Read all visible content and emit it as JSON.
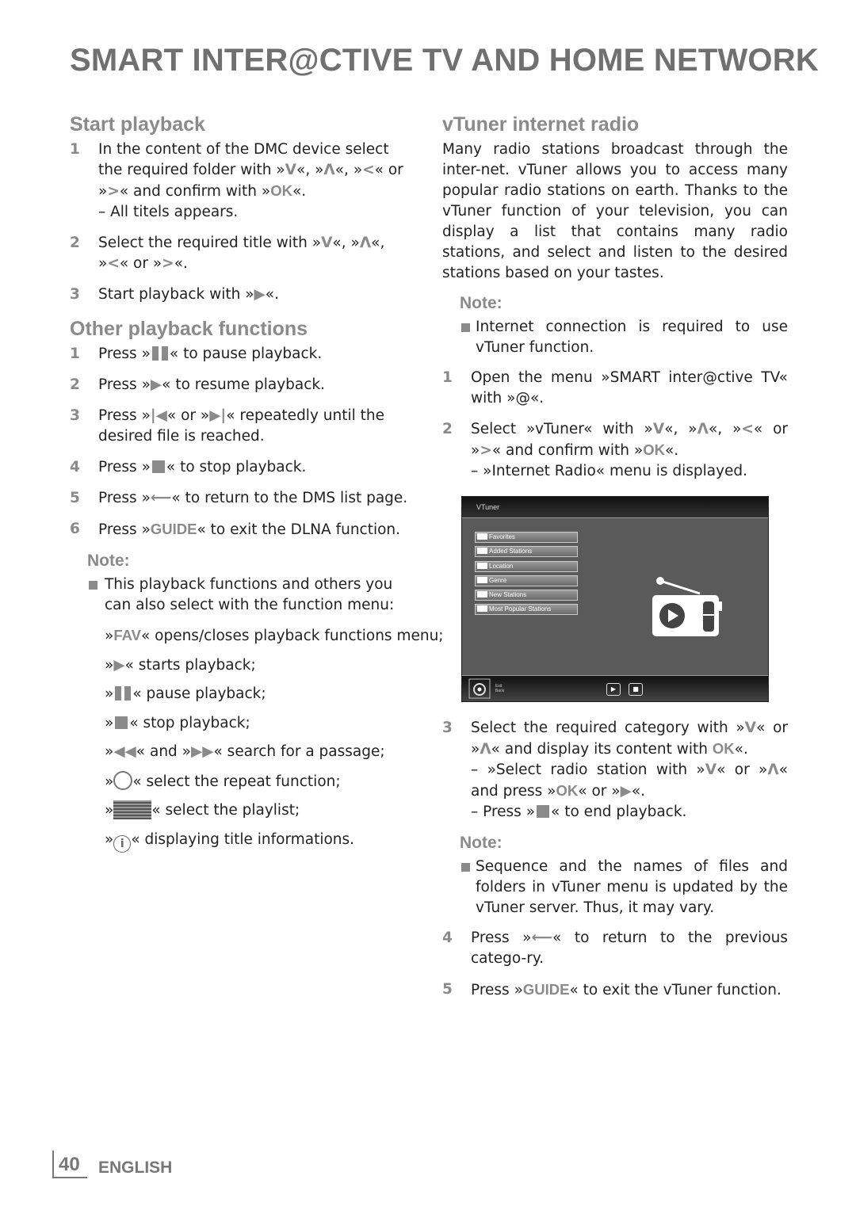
{
  "page_title": "SMART INTER@CTIVE TV AND HOME NETWORK",
  "colors": {
    "accent_gray": "#8a8a8a",
    "title_gray": "#707070"
  },
  "left": [
    {
      "type": "h",
      "text": "Start playback"
    },
    {
      "type": "step",
      "num": "1",
      "parts": [
        "In the content of the DMC device select the required folder with »",
        {
          "icon": "down"
        },
        "«, »",
        {
          "icon": "up"
        },
        "«, »",
        {
          "icon": "left"
        },
        "« or »",
        {
          "icon": "right"
        },
        "« and confirm with »",
        {
          "key": "OK"
        },
        "«."
      ],
      "sub": [
        "– All titels appears."
      ]
    },
    {
      "type": "step",
      "num": "2",
      "parts": [
        "Select the required title with »",
        {
          "icon": "down"
        },
        "«, »",
        {
          "icon": "up"
        },
        "«, »",
        {
          "icon": "left"
        },
        "« or »",
        {
          "icon": "right"
        },
        "«."
      ]
    },
    {
      "type": "step",
      "num": "3",
      "parts": [
        "Start playback with »",
        {
          "icon": "play"
        },
        "«."
      ]
    },
    {
      "type": "h2",
      "text": "Other playback functions"
    },
    {
      "type": "step",
      "num": "1",
      "parts": [
        "Press »",
        {
          "icon": "pause"
        },
        "« to pause playback."
      ]
    },
    {
      "type": "step",
      "num": "2",
      "parts": [
        "Press »",
        {
          "icon": "play"
        },
        "« to resume playback."
      ]
    },
    {
      "type": "step",
      "num": "3",
      "parts": [
        "Press »",
        {
          "icon": "prev"
        },
        "« or »",
        {
          "icon": "next"
        },
        "« repeatedly until the desired file is reached."
      ]
    },
    {
      "type": "step",
      "num": "4",
      "parts": [
        "Press »",
        {
          "icon": "stop"
        },
        "« to stop playback."
      ]
    },
    {
      "type": "step",
      "num": "5",
      "parts": [
        "Press »",
        {
          "icon": "back"
        },
        "« to return to the DMS list page."
      ]
    },
    {
      "type": "step",
      "num": "6",
      "parts": [
        "Press »",
        {
          "key": "GUIDE"
        },
        "« to exit the DLNA function."
      ]
    },
    {
      "type": "note",
      "text": "Note:"
    },
    {
      "type": "bullet",
      "parts": [
        "This playback functions and others you can also select with the function menu:"
      ]
    },
    {
      "type": "li",
      "parts": [
        "»",
        {
          "key": "FAV"
        },
        "« opens/closes playback functions menu;"
      ]
    },
    {
      "type": "li",
      "parts": [
        "»",
        {
          "icon": "play"
        },
        "« starts playback;"
      ]
    },
    {
      "type": "li",
      "parts": [
        "»",
        {
          "icon": "pause"
        },
        "« pause playback;"
      ]
    },
    {
      "type": "li",
      "parts": [
        "»",
        {
          "icon": "stop"
        },
        "« stop playback;"
      ]
    },
    {
      "type": "li",
      "parts": [
        "»",
        {
          "icon": "rewind"
        },
        "« and »",
        {
          "icon": "fast-forward"
        },
        "« search for a passage;"
      ]
    },
    {
      "type": "li",
      "parts": [
        "»",
        {
          "icon": "repeat"
        },
        "« select the repeat function;"
      ]
    },
    {
      "type": "li",
      "parts": [
        "»",
        {
          "icon": "playlist"
        },
        "« select the playlist;"
      ]
    },
    {
      "type": "li",
      "parts": [
        "»",
        {
          "icon": "info"
        },
        "« displaying title informations."
      ]
    }
  ],
  "right": [
    {
      "type": "h",
      "text": "vTuner internet radio"
    },
    {
      "type": "para",
      "parts": [
        "Many radio stations broadcast through the inter-net. vTuner allows you to access many popular radio stations on earth. Thanks to the vTuner function of your television, you can display a list that contains many radio stations, and select and listen to the desired stations based on your tastes."
      ]
    },
    {
      "type": "note",
      "text": "Note:"
    },
    {
      "type": "bullet",
      "parts": [
        "Internet connection is required to use vTuner function."
      ]
    },
    {
      "type": "step",
      "num": "1",
      "parts": [
        "Open the menu »SMART inter@ctive TV« with »@«."
      ]
    },
    {
      "type": "step",
      "num": "2",
      "parts": [
        "Select »vTuner« with »",
        {
          "icon": "down"
        },
        "«, »",
        {
          "icon": "up"
        },
        "«, »",
        {
          "icon": "left"
        },
        "« or »",
        {
          "icon": "right"
        },
        "« and confirm with »",
        {
          "key": "OK"
        },
        "«."
      ],
      "sub": [
        "– »Internet Radio« menu is displayed."
      ]
    },
    {
      "type": "screen"
    },
    {
      "type": "step",
      "num": "3",
      "parts": [
        "Select the required category with »",
        {
          "icon": "down"
        },
        "« or »",
        {
          "icon": "up"
        },
        "« and display its content with ",
        {
          "key": "OK"
        },
        "«."
      ],
      "subs": [
        [
          "– »Select radio station with »",
          {
            "icon": "down"
          },
          "« or »",
          {
            "icon": "up"
          },
          "« and press »",
          {
            "key": "OK"
          },
          "« or »",
          {
            "icon": "play"
          },
          "«."
        ],
        [
          "– Press »",
          {
            "icon": "stop"
          },
          "« to end playback."
        ]
      ]
    },
    {
      "type": "note",
      "text": "Note:"
    },
    {
      "type": "bullet",
      "parts": [
        "Sequence and the names of files and folders in vTuner menu is updated by the vTuner server. Thus, it may vary."
      ]
    },
    {
      "type": "step",
      "num": "4",
      "parts": [
        "Press »",
        {
          "icon": "back"
        },
        "« to return to the previous catego-ry."
      ]
    },
    {
      "type": "step",
      "num": "5",
      "parts": [
        "Press »",
        {
          "key": "GUIDE"
        },
        "« to exit the vTuner function."
      ]
    }
  ],
  "tv_screen": {
    "title": "VTuner",
    "menu_items": [
      "Favorites",
      "Added Stations",
      "Location",
      "Genre",
      "New Stations",
      "Most Popular Stations"
    ],
    "bottom_hint": [
      "Exit",
      "Back"
    ]
  },
  "footer": {
    "page_number": "40",
    "language": "ENGLISH"
  }
}
